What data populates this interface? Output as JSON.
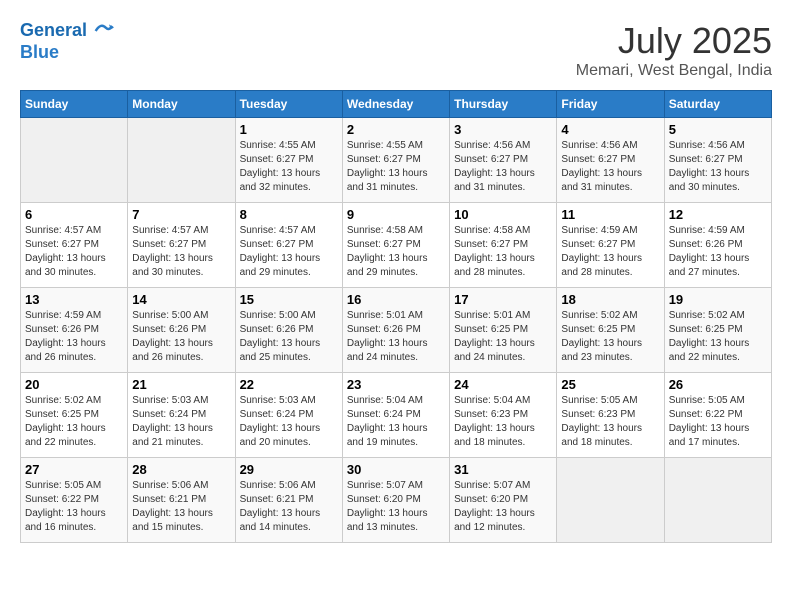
{
  "header": {
    "logo_line1": "General",
    "logo_line2": "Blue",
    "month_title": "July 2025",
    "location": "Memari, West Bengal, India"
  },
  "weekdays": [
    "Sunday",
    "Monday",
    "Tuesday",
    "Wednesday",
    "Thursday",
    "Friday",
    "Saturday"
  ],
  "weeks": [
    [
      {
        "day": "",
        "info": ""
      },
      {
        "day": "",
        "info": ""
      },
      {
        "day": "1",
        "info": "Sunrise: 4:55 AM\nSunset: 6:27 PM\nDaylight: 13 hours\nand 32 minutes."
      },
      {
        "day": "2",
        "info": "Sunrise: 4:55 AM\nSunset: 6:27 PM\nDaylight: 13 hours\nand 31 minutes."
      },
      {
        "day": "3",
        "info": "Sunrise: 4:56 AM\nSunset: 6:27 PM\nDaylight: 13 hours\nand 31 minutes."
      },
      {
        "day": "4",
        "info": "Sunrise: 4:56 AM\nSunset: 6:27 PM\nDaylight: 13 hours\nand 31 minutes."
      },
      {
        "day": "5",
        "info": "Sunrise: 4:56 AM\nSunset: 6:27 PM\nDaylight: 13 hours\nand 30 minutes."
      }
    ],
    [
      {
        "day": "6",
        "info": "Sunrise: 4:57 AM\nSunset: 6:27 PM\nDaylight: 13 hours\nand 30 minutes."
      },
      {
        "day": "7",
        "info": "Sunrise: 4:57 AM\nSunset: 6:27 PM\nDaylight: 13 hours\nand 30 minutes."
      },
      {
        "day": "8",
        "info": "Sunrise: 4:57 AM\nSunset: 6:27 PM\nDaylight: 13 hours\nand 29 minutes."
      },
      {
        "day": "9",
        "info": "Sunrise: 4:58 AM\nSunset: 6:27 PM\nDaylight: 13 hours\nand 29 minutes."
      },
      {
        "day": "10",
        "info": "Sunrise: 4:58 AM\nSunset: 6:27 PM\nDaylight: 13 hours\nand 28 minutes."
      },
      {
        "day": "11",
        "info": "Sunrise: 4:59 AM\nSunset: 6:27 PM\nDaylight: 13 hours\nand 28 minutes."
      },
      {
        "day": "12",
        "info": "Sunrise: 4:59 AM\nSunset: 6:26 PM\nDaylight: 13 hours\nand 27 minutes."
      }
    ],
    [
      {
        "day": "13",
        "info": "Sunrise: 4:59 AM\nSunset: 6:26 PM\nDaylight: 13 hours\nand 26 minutes."
      },
      {
        "day": "14",
        "info": "Sunrise: 5:00 AM\nSunset: 6:26 PM\nDaylight: 13 hours\nand 26 minutes."
      },
      {
        "day": "15",
        "info": "Sunrise: 5:00 AM\nSunset: 6:26 PM\nDaylight: 13 hours\nand 25 minutes."
      },
      {
        "day": "16",
        "info": "Sunrise: 5:01 AM\nSunset: 6:26 PM\nDaylight: 13 hours\nand 24 minutes."
      },
      {
        "day": "17",
        "info": "Sunrise: 5:01 AM\nSunset: 6:25 PM\nDaylight: 13 hours\nand 24 minutes."
      },
      {
        "day": "18",
        "info": "Sunrise: 5:02 AM\nSunset: 6:25 PM\nDaylight: 13 hours\nand 23 minutes."
      },
      {
        "day": "19",
        "info": "Sunrise: 5:02 AM\nSunset: 6:25 PM\nDaylight: 13 hours\nand 22 minutes."
      }
    ],
    [
      {
        "day": "20",
        "info": "Sunrise: 5:02 AM\nSunset: 6:25 PM\nDaylight: 13 hours\nand 22 minutes."
      },
      {
        "day": "21",
        "info": "Sunrise: 5:03 AM\nSunset: 6:24 PM\nDaylight: 13 hours\nand 21 minutes."
      },
      {
        "day": "22",
        "info": "Sunrise: 5:03 AM\nSunset: 6:24 PM\nDaylight: 13 hours\nand 20 minutes."
      },
      {
        "day": "23",
        "info": "Sunrise: 5:04 AM\nSunset: 6:24 PM\nDaylight: 13 hours\nand 19 minutes."
      },
      {
        "day": "24",
        "info": "Sunrise: 5:04 AM\nSunset: 6:23 PM\nDaylight: 13 hours\nand 18 minutes."
      },
      {
        "day": "25",
        "info": "Sunrise: 5:05 AM\nSunset: 6:23 PM\nDaylight: 13 hours\nand 18 minutes."
      },
      {
        "day": "26",
        "info": "Sunrise: 5:05 AM\nSunset: 6:22 PM\nDaylight: 13 hours\nand 17 minutes."
      }
    ],
    [
      {
        "day": "27",
        "info": "Sunrise: 5:05 AM\nSunset: 6:22 PM\nDaylight: 13 hours\nand 16 minutes."
      },
      {
        "day": "28",
        "info": "Sunrise: 5:06 AM\nSunset: 6:21 PM\nDaylight: 13 hours\nand 15 minutes."
      },
      {
        "day": "29",
        "info": "Sunrise: 5:06 AM\nSunset: 6:21 PM\nDaylight: 13 hours\nand 14 minutes."
      },
      {
        "day": "30",
        "info": "Sunrise: 5:07 AM\nSunset: 6:20 PM\nDaylight: 13 hours\nand 13 minutes."
      },
      {
        "day": "31",
        "info": "Sunrise: 5:07 AM\nSunset: 6:20 PM\nDaylight: 13 hours\nand 12 minutes."
      },
      {
        "day": "",
        "info": ""
      },
      {
        "day": "",
        "info": ""
      }
    ]
  ]
}
